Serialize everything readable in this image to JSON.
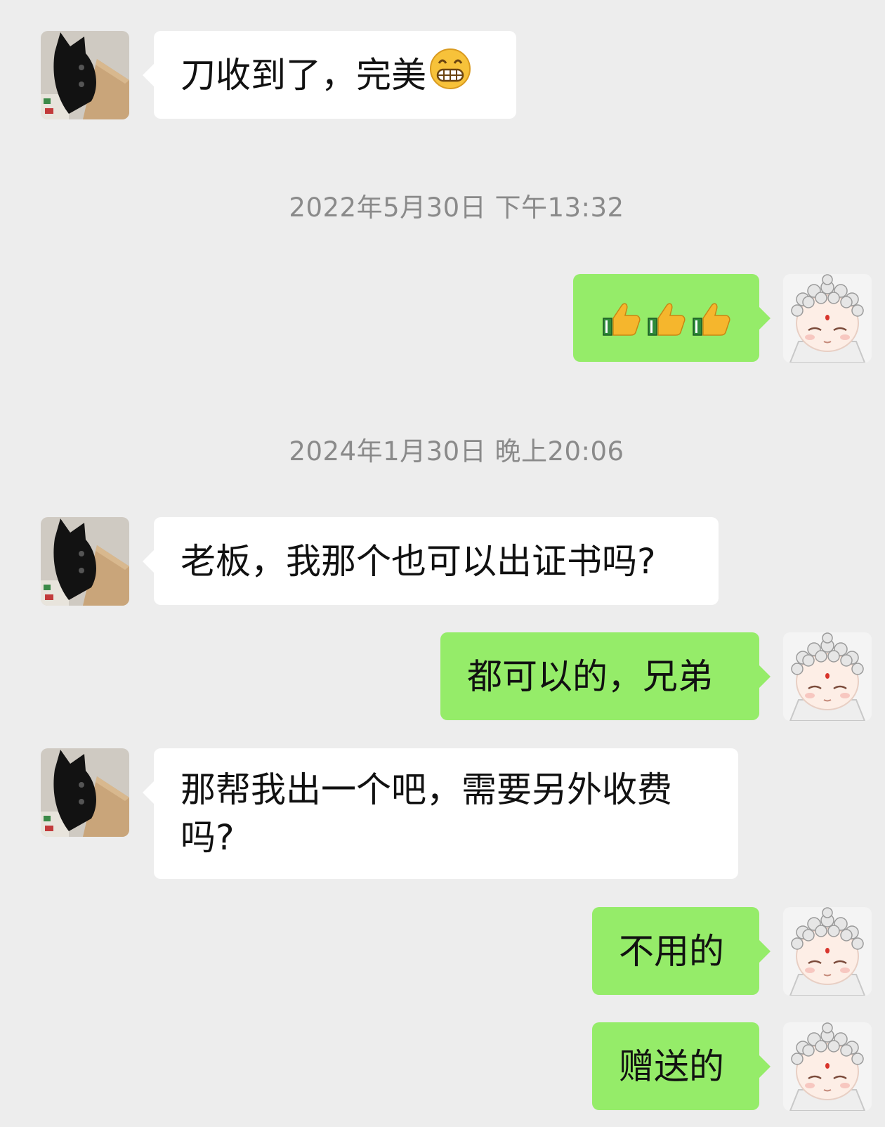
{
  "colors": {
    "background": "#ededed",
    "incoming_bubble": "#ffffff",
    "outgoing_bubble": "#95ec69",
    "timestamp_text": "#8a8a8a"
  },
  "timestamps": [
    "2022年5月30日 下午13:32",
    "2024年1月30日 晚上20:06"
  ],
  "messages": [
    {
      "side": "incoming",
      "text": "刀收到了，完美",
      "emoji": "grinning-face-icon"
    },
    {
      "side": "outgoing",
      "emoji": "thumbs-up-icon x3"
    },
    {
      "side": "incoming",
      "text": "老板，我那个也可以出证书吗?"
    },
    {
      "side": "outgoing",
      "text": "都可以的，兄弟"
    },
    {
      "side": "incoming",
      "text": "那帮我出一个吧，需要另外收费\n吗?"
    },
    {
      "side": "outgoing",
      "text": "不用的"
    },
    {
      "side": "outgoing",
      "text": "赠送的"
    }
  ]
}
